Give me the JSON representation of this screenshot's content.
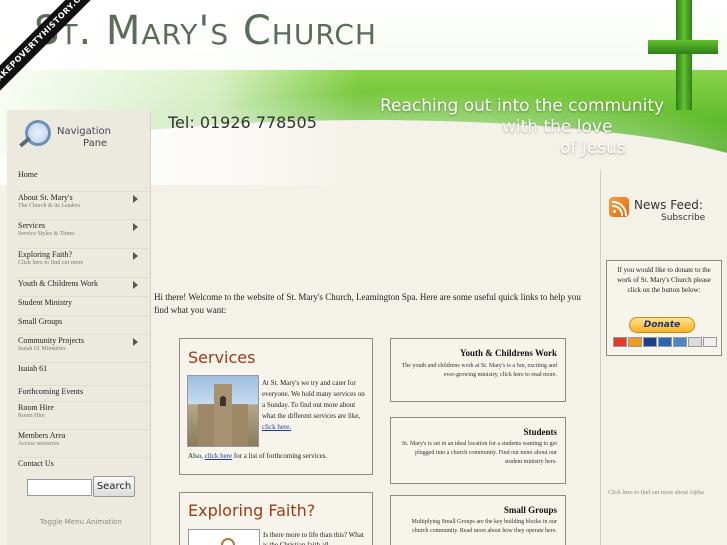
{
  "ribbon": "MAKEPOVERTYHISTORY.ORG",
  "header": {
    "title": "St. Mary's Church",
    "phone": "Tel: 01926 778505",
    "tagline": [
      "Reaching out into the community",
      "with the love",
      "of Jesus"
    ]
  },
  "nav_pane": {
    "line1": "Navigation",
    "line2": "Pane"
  },
  "nav": [
    {
      "label": "Home",
      "sub": ""
    },
    {
      "label": "About St. Mary's",
      "sub": "The Church & its Leaders"
    },
    {
      "label": "Services",
      "sub": "Service Styles & Times"
    },
    {
      "label": "Exploring Faith?",
      "sub": "Click here to find out more"
    },
    {
      "label": "Youth & Childrens Work",
      "sub": ""
    },
    {
      "label": "Student Ministry",
      "sub": ""
    },
    {
      "label": "Small Groups",
      "sub": ""
    },
    {
      "label": "Community Projects",
      "sub": "Isaiah 61 Ministries"
    },
    {
      "label": "Isaiah 61",
      "sub": ""
    },
    {
      "label": "Forthcoming Events",
      "sub": ""
    },
    {
      "label": "Room Hire",
      "sub": "Room Hire"
    },
    {
      "label": "Members Area",
      "sub": "Access resources"
    },
    {
      "label": "Contact Us",
      "sub": ""
    }
  ],
  "search": {
    "button": "Search",
    "value": ""
  },
  "toggle": "Toggle Menu Animation",
  "welcome": "Hi there! Welcome to the website of St. Mary's Church, Leamington Spa. Here are some useful quick links to help you find what you want:",
  "services": {
    "title": "Services",
    "text": "At St. Mary's we try and cater for everyone.  We hold many services on a Sunday.  To find out more about what the different services are like,",
    "link": "click here.",
    "also_pre": "Also,",
    "also_link": "click here",
    "also_post": "for a list of forthcoming services."
  },
  "faith": {
    "title": "Exploring Faith?",
    "text": "Is there more to life than this? What is the Christian faith all"
  },
  "youth": {
    "title": "Youth & Childrens Work",
    "text": "The youth and childrens work at St. Mary's is a fun, exciting and ever-growing ministry, click here to read more."
  },
  "students": {
    "title": "Students",
    "text": "St. Mary's is set in an ideal location for a students wanting to get plugged into a church community.  Find out more about our student ministry here."
  },
  "smallgroups": {
    "title": "Small Groups",
    "text": "Multiplying Small Groups are the key building blocks in our church community.  Read more about how they operate here."
  },
  "newsfeed": {
    "title": "News Feed:",
    "sub": "Subscribe"
  },
  "donate": {
    "text": "If you would like to donate to the work of St. Mary's Church please click on the button below:",
    "button": "Donate"
  },
  "alpha": "Click here to find out more about Alpha",
  "colors": {
    "accent_green": "#5fbb2a",
    "title_brown": "#a13a10",
    "link_blue": "#1a39b5"
  }
}
